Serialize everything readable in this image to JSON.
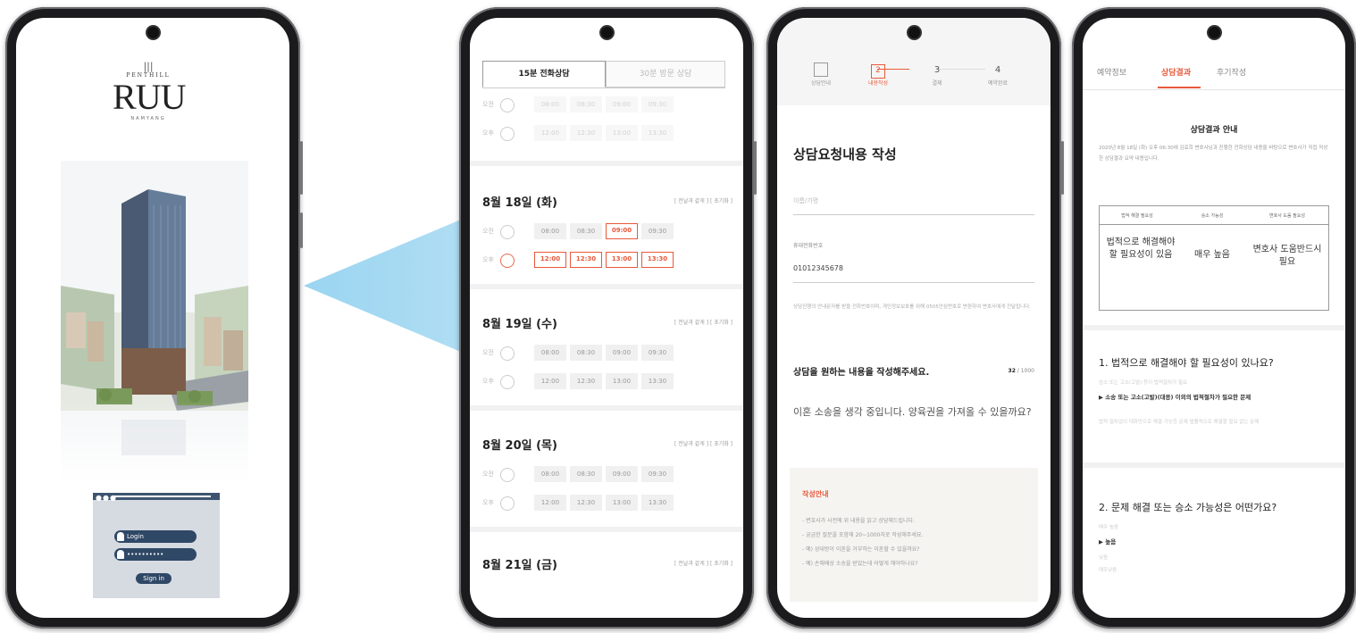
{
  "phone1": {
    "logo_mark": "|||",
    "logo_small": "PENTHILL",
    "logo_big": "RUU",
    "logo_sub": "NAMYANG",
    "login_placeholder": "Login",
    "password_placeholder": "••••••••••",
    "signin_label": "Sign in"
  },
  "phone2": {
    "tab_active": "15분 전화상담",
    "tab_inactive": "30분 방문 상담",
    "am": "오전",
    "pm": "오후",
    "times_am": [
      "08:00",
      "08:30",
      "09:00",
      "09:30"
    ],
    "times_pm": [
      "12:00",
      "12:30",
      "13:00",
      "13:30"
    ],
    "date_links": "[ 전날과 같게 ] [ 초기화 ]",
    "dates": [
      "8월 18일 (화)",
      "8월 19일 (수)",
      "8월 20일 (목)",
      "8월 21일 (금)"
    ]
  },
  "phone3": {
    "steps": [
      {
        "num": "",
        "label": "상담안내"
      },
      {
        "num": "2",
        "label": "내용작성"
      },
      {
        "num": "3",
        "label": "결제"
      },
      {
        "num": "4",
        "label": "예약완료"
      }
    ],
    "title": "상담요청내용 작성",
    "name_placeholder": "이름/가명",
    "phone_label": "휴대전화번호",
    "phone_value": "01012345678",
    "notice": "상담진행의 안내문자를 받을 전화번호이며, 개인정보보호를 위해 0505안심번호로 변환하여 변호사에게 전달됩니다.",
    "question": "상담을 원하는 내용을 작성해주세요.",
    "count": "32",
    "count_max": "/ 1000",
    "body": "이혼 소송을 생각 중입니다. 양육권을 가져올 수 있을까요?",
    "guide_title": "작성안내",
    "guide_lines": [
      "- 변호사가 사전에 위 내용을 읽고 상담해드립니다.",
      "- 궁금한 질문을 포함해 20~1000자로 작성해주세요.",
      "- 예) 상대방이 이혼을 거부하는 이혼할 수 있을까요?",
      "- 예) 손해배상 소송을 받았는데 어떻게 해야하나요?"
    ]
  },
  "phone4": {
    "tabs": [
      "예약정보",
      "상담결과",
      "후기작성"
    ],
    "result_title": "상담결과 안내",
    "result_desc": "2020년 8월 18일 (화) 오후 06:30에 김료희 변호사님과 진행한 전화상담 내용을 바탕으로 변호사가 직접 작성한 상담결과 요약 내용입니다.",
    "table_headers": [
      "법적 해결 필요성",
      "승소 가능성",
      "변호사 도움 필요성"
    ],
    "table_cells": [
      "법적으로 해결해야할 필요성이 있음",
      "매우 높음",
      "변호사 도움반드시 필요"
    ],
    "q1": "1. 법적으로 해결해야 할 필요성이 있나요?",
    "q1_sub": "승소 또는 고소(고발) 등이 법적절차가 필요",
    "q1_ans": "▶ 소송 또는 고소(고발)(대응) 이외의 법적절차가 필요한 문제",
    "q1_more": "법적 절차없이 대화만으로 해결 가능한 문제 법률적으로 해결할 필요 없는 문제",
    "q2": "2. 문제 해결 또는 승소 가능성은 어떤가요?",
    "q2_sub1": "매우 높음",
    "q2_ans": "▶ 높음",
    "q2_sub2": "낮음",
    "q2_sub3": "매우낮음"
  },
  "colors": {
    "accent": "#e8593b",
    "login_navy": "#2f4866",
    "beam": "#8fd0ef"
  }
}
